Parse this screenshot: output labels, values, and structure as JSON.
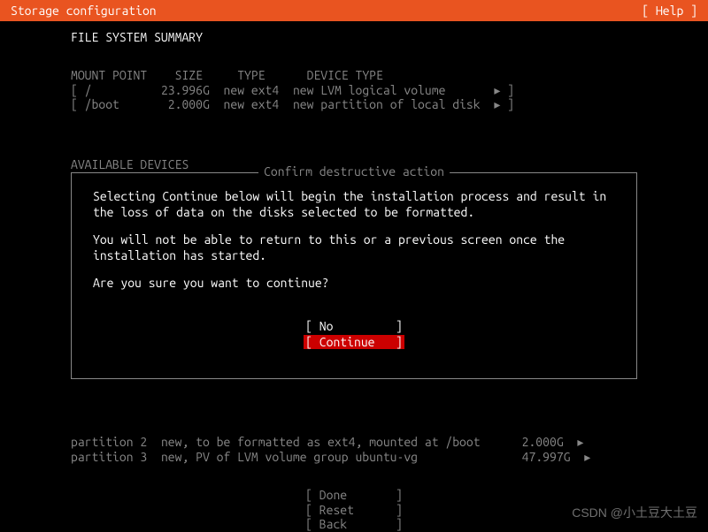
{
  "header": {
    "title": "Storage configuration",
    "help": "[ Help ]"
  },
  "fs_summary": {
    "title": "FILE SYSTEM SUMMARY",
    "headers": {
      "mount": "MOUNT POINT",
      "size": "SIZE",
      "type": "TYPE",
      "device": "DEVICE TYPE"
    },
    "rows": [
      {
        "mount": "[ /",
        "size": "23.996G",
        "type": "new ext4",
        "device": "new LVM logical volume",
        "arrow": "▸ ]"
      },
      {
        "mount": "[ /boot",
        "size": "2.000G",
        "type": "new ext4",
        "device": "new partition of local disk",
        "arrow": "▸ ]"
      }
    ]
  },
  "available_devices": {
    "title": "AVAILABLE DEVICES"
  },
  "dialog": {
    "title": "Confirm destructive action",
    "p1": "Selecting Continue below will begin the installation process and result in the loss of data on the disks selected to be formatted.",
    "p2": "You will not be able to return to this or a previous screen once the installation has started.",
    "p3": "Are you sure you want to continue?",
    "no": "[ No         ]",
    "continue": "[ Continue   ]"
  },
  "partitions": [
    {
      "name": "partition 2",
      "desc": "new, to be formatted as ext4, mounted at /boot",
      "size": "2.000G",
      "arrow": "▸"
    },
    {
      "name": "partition 3",
      "desc": "new, PV of LVM volume group ubuntu-vg",
      "size": "47.997G",
      "arrow": "▸"
    }
  ],
  "footer": {
    "done": "[ Done       ]",
    "reset": "[ Reset      ]",
    "back": "[ Back       ]"
  },
  "watermark": "CSDN @小土豆大土豆"
}
